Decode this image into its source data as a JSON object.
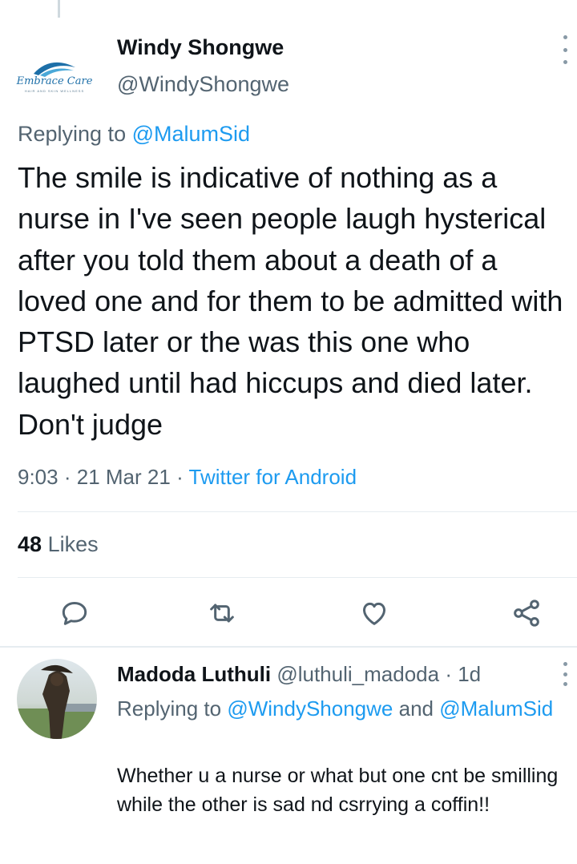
{
  "tweet": {
    "logo": {
      "name": "Embrace Care",
      "tagline": "HAIR AND SKIN WELLNESS"
    },
    "author_name": "Windy Shongwe",
    "author_handle": "@WindyShongwe",
    "replying_prefix": "Replying to",
    "replying_to": "@MalumSid",
    "text": "The smile is indicative of nothing as a nurse in I've seen people laugh hysterical after you told them about a death of a loved one and for them to be admitted with PTSD later or the was this one who laughed until had hiccups and died later. Don't judge",
    "time": "9:03",
    "date": "21 Mar 21",
    "dot": "·",
    "source": "Twitter for Android",
    "likes_count": "48",
    "likes_label": "Likes"
  },
  "actions": {
    "reply_icon": "comment-icon",
    "retweet_icon": "retweet-icon",
    "like_icon": "heart-icon",
    "share_icon": "share-icon"
  },
  "reply": {
    "author_name": "Madoda Luthuli",
    "author_handle": "@luthuli_madoda",
    "dot": "·",
    "age": "1d",
    "replying_prefix": "Replying to",
    "replying_to_1": "@WindyShongwe",
    "and_label": "and",
    "replying_to_2": "@MalumSid",
    "text": "Whether u a nurse or what but one cnt be smilling while the other is sad nd csrrying a coffin!!"
  },
  "colors": {
    "accent": "#1d9bf0",
    "secondary_text": "#536471",
    "primary_text": "#0f1419"
  }
}
